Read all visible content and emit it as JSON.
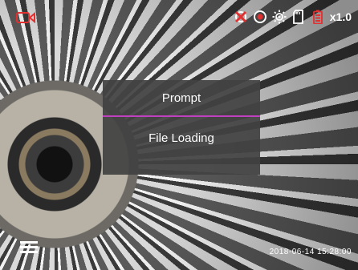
{
  "topbar": {
    "icons": [
      "video-record-icon",
      "no-gps-icon",
      "record-dot-icon",
      "light-sensor-icon",
      "sd-card-icon",
      "battery-icon"
    ],
    "zoom": "x1.0"
  },
  "dialog": {
    "title": "Prompt",
    "message": "File Loading"
  },
  "footer": {
    "date": "2018-06-14",
    "time": "15:28:00"
  },
  "colors": {
    "accent": "#e03030",
    "divider": "#c040c0"
  }
}
